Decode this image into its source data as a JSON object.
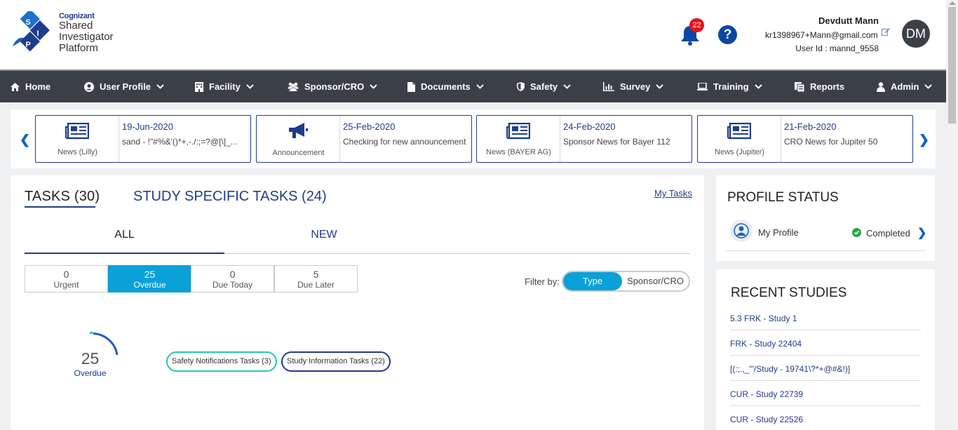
{
  "logo": {
    "brand": "Cognizant",
    "line1": "Shared",
    "line2": "Investigator",
    "line3": "Platform",
    "mark_letters": [
      "S",
      "I",
      "P"
    ]
  },
  "header": {
    "notification_count": "22",
    "help_glyph": "?",
    "user_name": "Devdutt Mann",
    "user_email": "kr1398967+Mann@gmail.com",
    "user_id": "User Id : mannd_9558",
    "avatar_initials": "DM"
  },
  "nav": {
    "items": [
      {
        "label": "Home",
        "icon": "home-icon"
      },
      {
        "label": "User Profile",
        "icon": "user-circle-icon"
      },
      {
        "label": "Facility",
        "icon": "building-icon"
      },
      {
        "label": "Sponsor/CRO",
        "icon": "users-icon"
      },
      {
        "label": "Documents",
        "icon": "document-icon"
      },
      {
        "label": "Safety",
        "icon": "shield-icon"
      },
      {
        "label": "Survey",
        "icon": "bar-chart-icon"
      },
      {
        "label": "Training",
        "icon": "laptop-icon"
      },
      {
        "label": "Reports",
        "icon": "reports-icon"
      },
      {
        "label": "Admin",
        "icon": "person-icon"
      }
    ]
  },
  "news": [
    {
      "category": "News (Lilly)",
      "date": "19-Jun-2020",
      "text": "sand - !\"#%&'()*+,-./:;=?@[\\]_..."
    },
    {
      "category": "Announcement",
      "date": "25-Feb-2020",
      "text": "Checking for new announcement"
    },
    {
      "category": "News (BAYER AG)",
      "date": "24-Feb-2020",
      "text": "Sponsor News for Bayer 112"
    },
    {
      "category": "News (Jupiter)",
      "date": "21-Feb-2020",
      "text": "CRO News for Jupiter 50"
    }
  ],
  "tasks": {
    "tab_tasks": "TASKS (30)",
    "tab_study": "STUDY SPECIFIC TASKS (24)",
    "my_tasks_link": "My Tasks",
    "sub_all": "ALL",
    "sub_new": "NEW",
    "counts": [
      {
        "value": "0",
        "label": "Urgent"
      },
      {
        "value": "25",
        "label": "Overdue"
      },
      {
        "value": "0",
        "label": "Due Today"
      },
      {
        "value": "5",
        "label": "Due Later"
      }
    ],
    "filter_label": "Filter by:",
    "filter_type": "Type",
    "filter_sponsor": "Sponsor/CRO",
    "donut_value": "25",
    "donut_label": "Overdue",
    "legend": [
      {
        "label": "Safety Notifications Tasks (3)",
        "color": "#26c6b5"
      },
      {
        "label": "Study Information Tasks (22)",
        "color": "#1f3d8c"
      }
    ]
  },
  "profile": {
    "title": "PROFILE STATUS",
    "item_label": "My Profile",
    "status": "Completed"
  },
  "recent": {
    "title": "RECENT STUDIES",
    "items": [
      "5.3 FRK - Study 1",
      "FRK - Study 22404",
      "[(:;.,_'\"/Study - 19741\\?*+@#&!)]",
      "CUR - Study 22739",
      "CUR - Study 22526"
    ]
  },
  "colors": {
    "nav_bg": "#3b4047",
    "accent": "#0aa0d8",
    "brand_blue": "#1f3d8c",
    "badge_red": "#e8121b"
  }
}
